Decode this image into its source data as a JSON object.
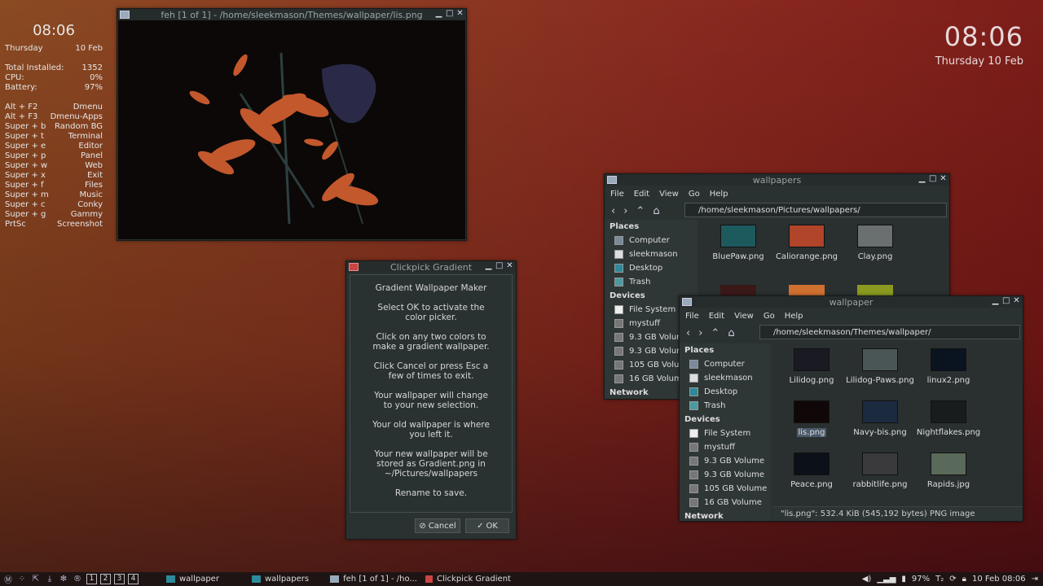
{
  "conky": {
    "time": "08:06",
    "day": "Thursday",
    "date": "10 Feb",
    "stats": [
      {
        "label": "Total Installed:",
        "value": "1352"
      },
      {
        "label": "CPU:",
        "value": "0%"
      },
      {
        "label": "Battery:",
        "value": "97%"
      }
    ],
    "shortcuts": [
      {
        "key": "Alt + F2",
        "action": "Dmenu"
      },
      {
        "key": "Alt + F3",
        "action": "Dmenu-Apps"
      },
      {
        "key": "Super + b",
        "action": "Random BG"
      },
      {
        "key": "Super + t",
        "action": "Terminal"
      },
      {
        "key": "Super + e",
        "action": "Editor"
      },
      {
        "key": "Super + p",
        "action": "Panel"
      },
      {
        "key": "Super + w",
        "action": "Web"
      },
      {
        "key": "Super + x",
        "action": "Exit"
      },
      {
        "key": "Super + f",
        "action": "Files"
      },
      {
        "key": "Super + m",
        "action": "Music"
      },
      {
        "key": "Super + c",
        "action": "Conky"
      },
      {
        "key": "Super + g",
        "action": "Gammy"
      },
      {
        "key": "PrtSc",
        "action": "Screenshot"
      }
    ]
  },
  "bigclock": {
    "time": "08:06",
    "date": "Thursday 10 Feb"
  },
  "feh": {
    "title": "feh [1 of 1] - /home/sleekmason/Themes/wallpaper/lis.png"
  },
  "dialog": {
    "title": "Clickpick Gradient",
    "lines": [
      "Gradient Wallpaper Maker",
      "Select OK to activate the\ncolor picker.",
      "Click on any two colors to\nmake a gradient wallpaper.",
      "Click Cancel or press Esc a\nfew of times to exit.",
      "Your wallpaper will change\nto your new selection.",
      "Your old wallpaper is where\nyou left it.",
      "Your new wallpaper will be\nstored as Gradient.png in\n~/Pictures/wallpapers",
      "Rename to save."
    ],
    "cancel": "Cancel",
    "ok": "OK"
  },
  "menus": [
    "File",
    "Edit",
    "View",
    "Go",
    "Help"
  ],
  "fm1": {
    "title": "wallpapers",
    "path": "/home/sleekmason/Pictures/wallpapers/",
    "places_header": "Places",
    "places": [
      "Computer",
      "sleekmason",
      "Desktop",
      "Trash"
    ],
    "devices_header": "Devices",
    "devices": [
      "File System",
      "mystuff",
      "9.3 GB Volume",
      "9.3 GB Volume",
      "105 GB Volume",
      "16 GB Volume"
    ],
    "network_header": "Network",
    "files": [
      {
        "name": "BluePaw.png",
        "color": "#1d5a5e"
      },
      {
        "name": "Caliorange.png",
        "color": "#b0452a"
      },
      {
        "name": "Clay.png",
        "color": "#6a7070"
      }
    ]
  },
  "fm2": {
    "title": "wallpaper",
    "path": "/home/sleekmason/Themes/wallpaper/",
    "places_header": "Places",
    "places": [
      "Computer",
      "sleekmason",
      "Desktop",
      "Trash"
    ],
    "devices_header": "Devices",
    "devices": [
      "File System",
      "mystuff",
      "9.3 GB Volume",
      "9.3 GB Volume",
      "105 GB Volume",
      "16 GB Volume"
    ],
    "network_header": "Network",
    "files": [
      {
        "name": "Lilidog.png",
        "color": "#1a1a22"
      },
      {
        "name": "Lilidog-Paws.png",
        "color": "#4a5655"
      },
      {
        "name": "linux2.png",
        "color": "#0a1420"
      },
      {
        "name": "lis.png",
        "color": "#100808"
      },
      {
        "name": "Navy-bis.png",
        "color": "#1c2a40"
      },
      {
        "name": "Nightflakes.png",
        "color": "#181c1c"
      },
      {
        "name": "Peace.png",
        "color": "#0c1018"
      },
      {
        "name": "rabbitlife.png",
        "color": "#3a3a3c"
      },
      {
        "name": "Rapids.jpg",
        "color": "#5a6a5a"
      }
    ],
    "status": "\"lis.png\": 532.4 KiB (545,192 bytes) PNG image"
  },
  "taskbar": {
    "workspaces": [
      "1",
      "2",
      "3",
      "4"
    ],
    "tasks": [
      "wallpaper",
      "wallpapers",
      "feh [1 of 1] - /ho...",
      "Clickpick Gradient"
    ],
    "battery": "97%",
    "clock": "10 Feb 08:06"
  }
}
